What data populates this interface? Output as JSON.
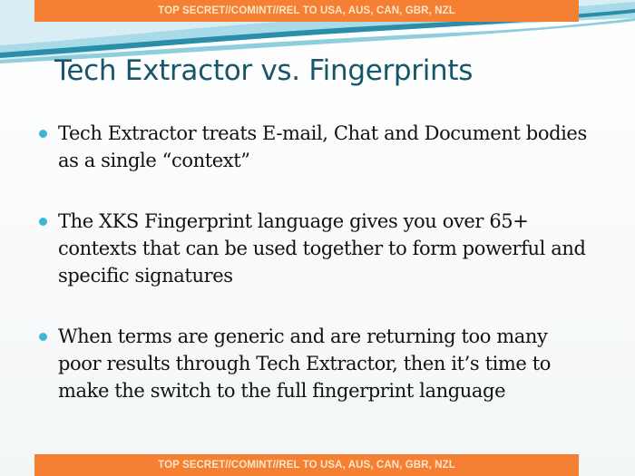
{
  "banner": {
    "classification": "TOP SECRET//COMINT//REL TO USA, AUS, CAN, GBR, NZL"
  },
  "slide": {
    "title": "Tech Extractor vs. Fingerprints",
    "bullets": [
      "Tech Extractor treats E-mail, Chat and Document bodies as a single “context”",
      "The XKS Fingerprint language gives you over 65+ contexts that can be used together to form powerful and specific signatures",
      "When terms are generic and are returning too many poor results through Tech Extractor, then it’s time to make the switch to the full fingerprint language"
    ]
  },
  "colors": {
    "banner_bg": "#f57f32",
    "banner_text": "#fde6c8",
    "title": "#17566a",
    "bullet_dot": "#3cb7d6",
    "wave_dark": "#2a8ea8",
    "wave_light": "#9fd6e4"
  }
}
